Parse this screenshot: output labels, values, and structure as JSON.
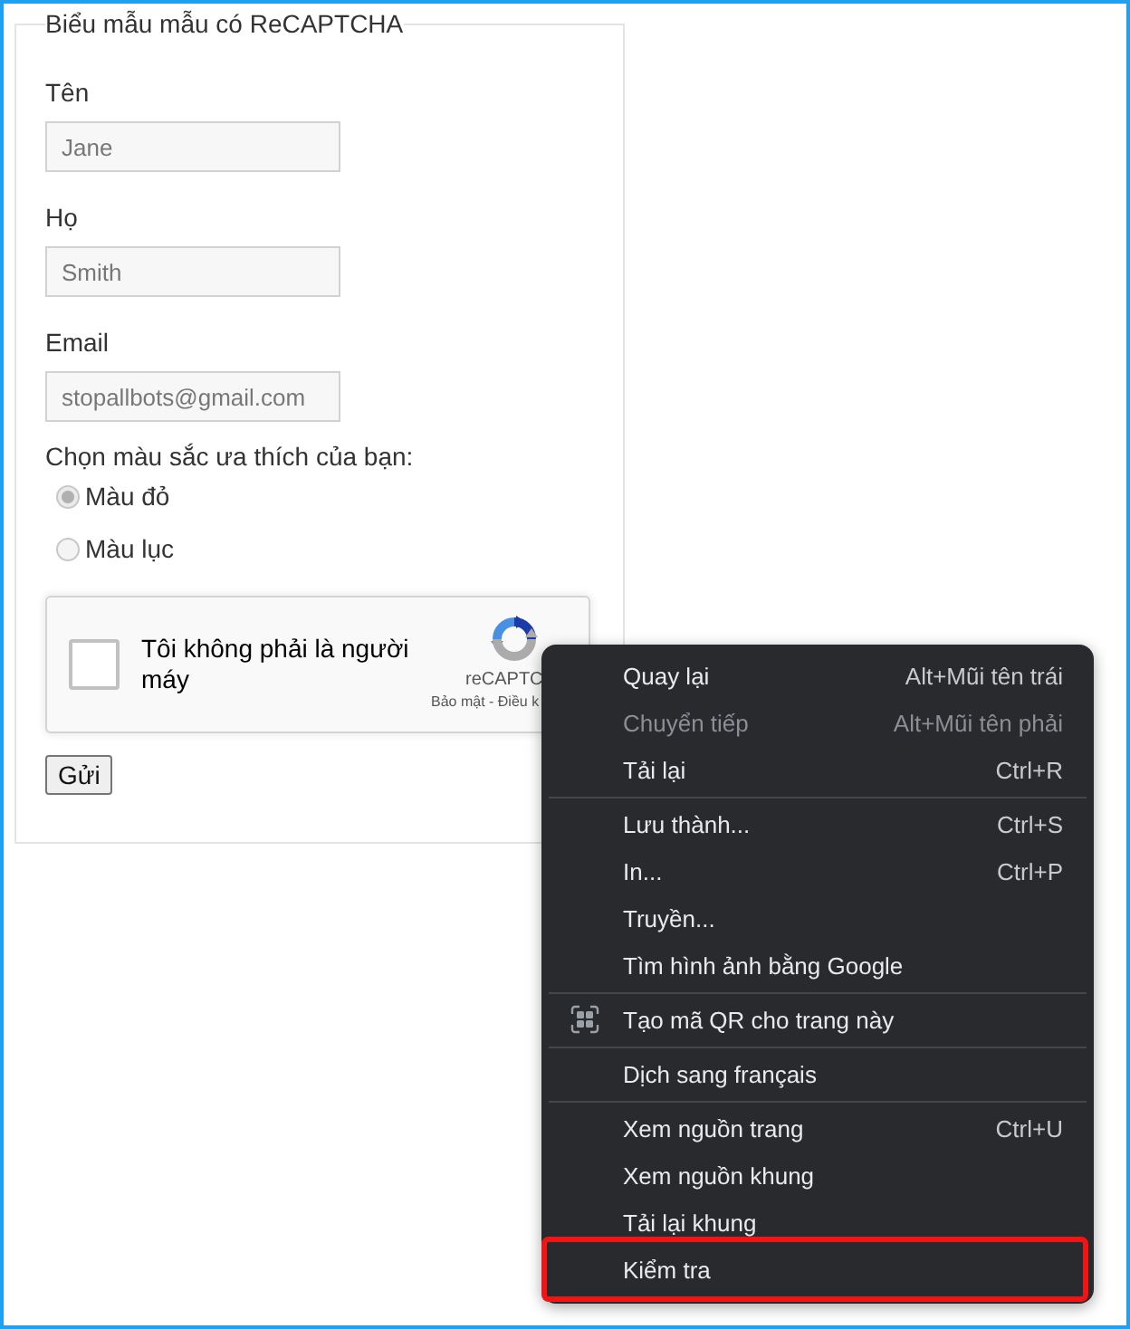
{
  "form": {
    "legend": "Biểu mẫu mẫu có ReCAPTCHA",
    "fields": [
      {
        "label": "Tên",
        "value": "Jane",
        "disabled": true
      },
      {
        "label": "Họ",
        "value": "Smith",
        "disabled": true
      },
      {
        "label": "Email",
        "value": "stopallbots@gmail.com",
        "disabled": true
      }
    ],
    "color_question": "Chọn màu sắc ưa thích của bạn:",
    "color_options": [
      {
        "label": "Màu đỏ",
        "selected": true,
        "disabled": true
      },
      {
        "label": "Màu lục",
        "selected": false,
        "disabled": true
      }
    ],
    "captcha": {
      "checkbox_label": "Tôi không phải là người máy",
      "checked": false,
      "brand": "reCAPTC",
      "links": "Bảo mật - Điều k"
    },
    "submit_button": "Gửi"
  },
  "context_menu": {
    "groups": [
      {
        "items": [
          {
            "label": "Quay lại",
            "shortcut": "Alt+Mũi tên trái",
            "kind": "plain",
            "disabled": false,
            "highlighted": false
          },
          {
            "label": "Chuyển tiếp",
            "shortcut": "Alt+Mũi tên phải",
            "kind": "plain",
            "disabled": true,
            "highlighted": false
          },
          {
            "label": "Tải lại",
            "shortcut": "Ctrl+R",
            "kind": "plain",
            "disabled": false,
            "highlighted": false
          }
        ]
      },
      {
        "items": [
          {
            "label": "Lưu thành...",
            "shortcut": "Ctrl+S",
            "kind": "plain",
            "disabled": false,
            "highlighted": false
          },
          {
            "label": "In...",
            "shortcut": "Ctrl+P",
            "kind": "plain",
            "disabled": false,
            "highlighted": false
          },
          {
            "label": "Truyền...",
            "kind": "plain",
            "disabled": false,
            "highlighted": false
          },
          {
            "label": "Tìm hình ảnh bằng Google",
            "kind": "plain",
            "disabled": false,
            "highlighted": false
          }
        ]
      },
      {
        "items": [
          {
            "label": "Tạo mã QR cho trang này",
            "kind": "icon",
            "disabled": false,
            "highlighted": false
          }
        ]
      },
      {
        "items": [
          {
            "label": "Dịch sang français",
            "kind": "plain",
            "disabled": false,
            "highlighted": false
          }
        ]
      },
      {
        "items": [
          {
            "label": "Xem nguồn trang",
            "shortcut": "Ctrl+U",
            "kind": "plain",
            "disabled": false,
            "highlighted": false
          },
          {
            "label": "Xem nguồn khung",
            "kind": "plain",
            "disabled": false,
            "highlighted": false
          },
          {
            "label": "Tải lại khung",
            "kind": "plain",
            "disabled": false,
            "highlighted": false
          },
          {
            "label": "Kiểm tra",
            "kind": "plain",
            "disabled": false,
            "highlighted": true
          }
        ]
      }
    ]
  }
}
